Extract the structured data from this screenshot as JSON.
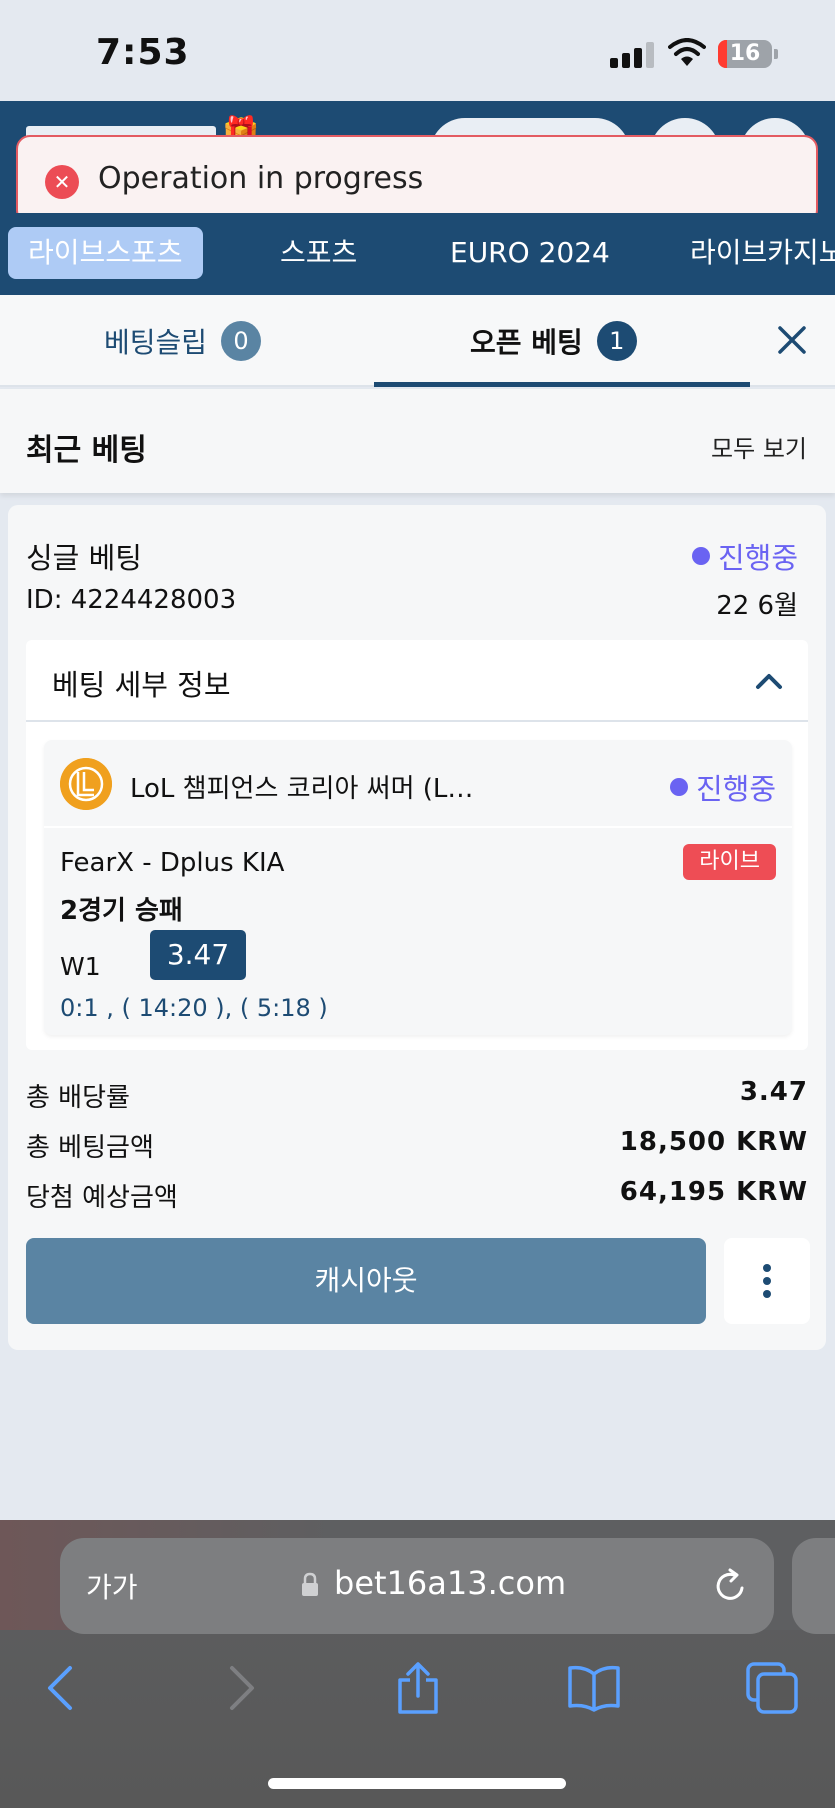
{
  "status_bar": {
    "time": "7:53",
    "battery": "16",
    "battery_level": 0.16
  },
  "toast": {
    "message": "Operation in progress"
  },
  "nav": {
    "items": [
      {
        "label": "라이브스포츠",
        "active": true
      },
      {
        "label": "스포츠"
      },
      {
        "label": "EURO 2024"
      },
      {
        "label": "라이브카지노"
      }
    ]
  },
  "slip_tabs": {
    "betslip_label": "베팅슬립",
    "betslip_count": "0",
    "open_label": "오픈 베팅",
    "open_count": "1"
  },
  "recent": {
    "title": "최근 베팅",
    "view_all": "모두 보기"
  },
  "bet": {
    "type": "싱글 베팅",
    "status": "진행중",
    "id": "ID: 4224428003",
    "date": "22 6월",
    "details_title": "베팅 세부 정보",
    "event": {
      "league": "LoL 챔피언스 코리아 써머 (L…",
      "status": "진행중",
      "teams": "FearX - Dplus KIA",
      "live_badge": "라이브",
      "market": "2경기 승패",
      "outcome": "W1",
      "odds": "3.47",
      "score": "0:1 , ( 14:20 ), ( 5:18 )"
    },
    "totals": [
      {
        "label": "총 배당률",
        "value": "3.47"
      },
      {
        "label": "총 베팅금액",
        "value": "18,500 KRW"
      },
      {
        "label": "당첨 예상금액",
        "value": "64,195 KRW"
      }
    ],
    "cashout_label": "캐시아웃"
  },
  "safari": {
    "aa": "가가",
    "url": "bet16a13.com"
  },
  "colors": {
    "primary": "#1d4b73",
    "accent_status": "#6a63f2",
    "live": "#ee4d55",
    "cashout": "#5a84a3",
    "toast_border": "#e35b62"
  }
}
